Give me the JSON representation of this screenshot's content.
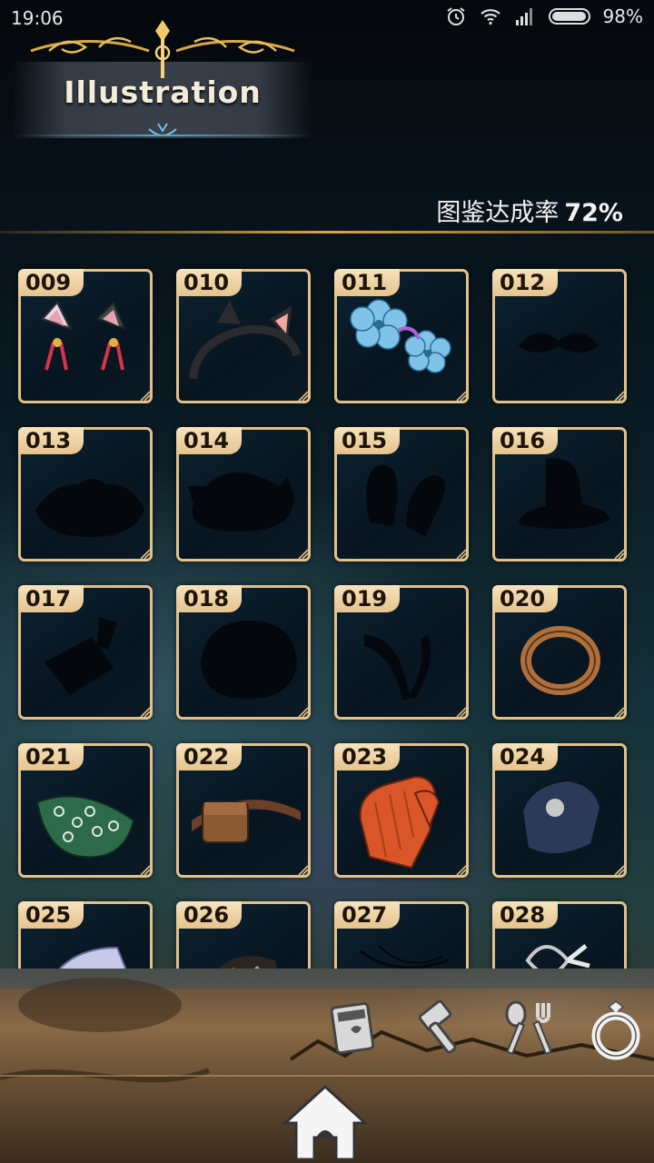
{
  "status_bar": {
    "time": "19:06",
    "battery": "98%",
    "icons": [
      "alarm-icon",
      "wifi-icon",
      "signal-icon",
      "battery-icon"
    ]
  },
  "header": {
    "title": "Illustration"
  },
  "completion": {
    "label": "图鉴达成率",
    "value": "72%"
  },
  "items": [
    {
      "num": "009",
      "art": "cat-ears-clips"
    },
    {
      "num": "010",
      "art": "cat-ear-headband"
    },
    {
      "num": "011",
      "art": "blue-flower-clips"
    },
    {
      "num": "012",
      "art": "mustache-silhouette"
    },
    {
      "num": "013",
      "art": "hat-silhouette"
    },
    {
      "num": "014",
      "art": "bow-cap-silhouette"
    },
    {
      "num": "015",
      "art": "bunny-ears-silhouette"
    },
    {
      "num": "016",
      "art": "witch-hat-silhouette"
    },
    {
      "num": "017",
      "art": "cleaver-silhouette"
    },
    {
      "num": "018",
      "art": "hood-silhouette"
    },
    {
      "num": "019",
      "art": "horns-silhouette"
    },
    {
      "num": "020",
      "art": "copper-ring"
    },
    {
      "num": "021",
      "art": "green-bandana"
    },
    {
      "num": "022",
      "art": "leather-belt-pouch"
    },
    {
      "num": "023",
      "art": "orange-oven-mitt"
    },
    {
      "num": "024",
      "art": "blue-gauntlet"
    },
    {
      "num": "025",
      "art": "white-armor"
    },
    {
      "num": "026",
      "art": "dark-glove"
    },
    {
      "num": "027",
      "art": "necklace-silhouette"
    },
    {
      "num": "028",
      "art": "silver-charm"
    }
  ],
  "bottom_nav": {
    "buttons": [
      {
        "name": "book-icon"
      },
      {
        "name": "hammer-icon"
      },
      {
        "name": "fork-spoon-icon"
      },
      {
        "name": "ring-icon"
      }
    ],
    "home": "home-icon"
  }
}
